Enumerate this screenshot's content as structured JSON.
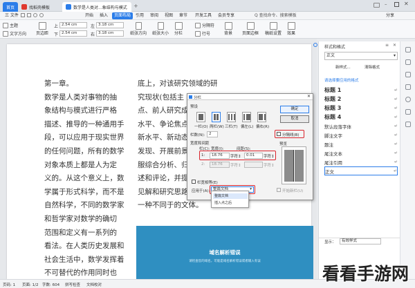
{
  "tabs": {
    "home": "首页",
    "template": "找稻壳模板",
    "doc": "数学是人类对...象结构与模式"
  },
  "menubar": {
    "file": "三 文件",
    "items": [
      "开始",
      "插入",
      "页面布局",
      "引用",
      "审阅",
      "视图",
      "章节",
      "开发工具",
      "会员专享"
    ],
    "search": "Q 查找命令、搜索模板",
    "share": "分享"
  },
  "ribbon": {
    "theme": "主题",
    "text_dir": "文字方向",
    "margins": "页边距",
    "top_label": "上",
    "top_val": "2.54 cm",
    "bottom_label": "下",
    "bottom_val": "2.54 cm",
    "left_label": "左",
    "left_val": "3.18 cm",
    "right_label": "右",
    "right_val": "3.18 cm",
    "orientation": "纸张方向",
    "size": "纸张大小",
    "columns": "分栏",
    "separator": "分隔符",
    "line_number": "行号",
    "background": "背景",
    "border": "页面边框",
    "draft_grid": "稿纸设置",
    "effects": "效果"
  },
  "doc": {
    "col1": [
      "第一章。",
      "数学是人类对事物的抽",
      "象结构与模式进行严格",
      "描述、推导的一种通用手",
      "段，可以应用于现实世界",
      "的任何问题，所有的数学",
      "对象本质上都是人为定",
      "义的。从这个意义上，数",
      "学属于形式科学，而不是",
      "自然科学，不同的数学家",
      "和哲学家对数学的确切",
      "范围和定义有一系列的",
      "看法。在人类历史发展和",
      "社会生活中，数学发挥着",
      "不可替代的作用同时也"
    ],
    "col2": [
      "底上，对该研究领域的研",
      "究现状(包括主",
      "点、前人研究成",
      "水平、争论焦点",
      "新水平、新动态",
      "发现、开展前景",
      "服综合分析、归",
      "述和评论，并提",
      "见解和研究思路",
      "一种不同于的文体。"
    ]
  },
  "banner": {
    "title": "域名解析错误",
    "subtitle": "请检查您的域名，可能是域名解析错误或者输入有误"
  },
  "dialog": {
    "title": "分栏",
    "preset_label": "预设",
    "presets": [
      "一栏(O)",
      "两栏(W)",
      "三栏(T)",
      "偏左(L)",
      "偏右(R)"
    ],
    "columns_label": "栏数(N):",
    "columns_val": "2",
    "line_label": "分隔线(B)",
    "width_spacing_label": "宽度和间距",
    "col_header": "栏(C):",
    "width_header": "宽度(I):",
    "spacing_header": "间距(S):",
    "rows": [
      {
        "col": "1:",
        "width": "18.76",
        "unit": "字符↕",
        "spacing": "0.01",
        "unit2": "字符↕"
      },
      {
        "col": "2:",
        "width": "18.76",
        "unit": "字符↕",
        "spacing": "",
        "unit2": "字符↕"
      }
    ],
    "equal_label": "栏宽相等(E)",
    "apply_label": "应用于(A):",
    "apply_val": "整篇文档",
    "preview_label": "预览",
    "new_col_label": "开始新栏(U)",
    "ok": "确定",
    "cancel": "取消"
  },
  "apply_options": [
    "整篇文档",
    "插入点之后"
  ],
  "side": {
    "title": "样式和格式",
    "current": "正文",
    "new_style": "新样式...",
    "clear": "清除格式",
    "subhead": "请选择要应用的格式",
    "items": [
      {
        "label": "标题 1",
        "bold": true
      },
      {
        "label": "标题 2",
        "bold": true
      },
      {
        "label": "标题 3",
        "bold": true
      },
      {
        "label": "标题 4",
        "bold": true
      },
      {
        "label": "默认段落字体",
        "bold": false
      },
      {
        "label": "脚注文字",
        "bold": false
      },
      {
        "label": "题注",
        "bold": false
      },
      {
        "label": "尾注文本",
        "bold": false
      },
      {
        "label": "尾注引用",
        "bold": false
      },
      {
        "label": "正文",
        "bold": false
      }
    ],
    "show": "显示：",
    "show_val": "有效样式",
    "ret": "↵"
  },
  "status": {
    "page": "页码: 1",
    "pages": "页面: 1/2",
    "words": "字数: 604",
    "spell": "拼写检查",
    "doc_check": "文档校对"
  },
  "watermark": "看看手游网",
  "colors": {
    "accent": "#2b7de9",
    "highlight": "#d9222a",
    "banner": "#2f8fc1"
  }
}
